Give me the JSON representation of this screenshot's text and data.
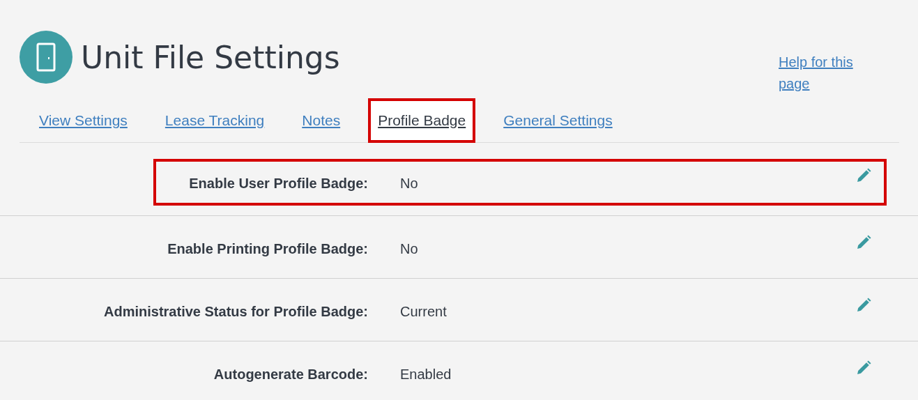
{
  "header": {
    "title": "Unit File Settings",
    "help_link": "Help for this page"
  },
  "tabs": [
    {
      "label": "View Settings",
      "selected": false,
      "highlighted": false
    },
    {
      "label": "Lease Tracking",
      "selected": false,
      "highlighted": false
    },
    {
      "label": "Notes",
      "selected": false,
      "highlighted": false
    },
    {
      "label": "Profile Badge",
      "selected": true,
      "highlighted": true
    },
    {
      "label": "General Settings",
      "selected": false,
      "highlighted": false
    }
  ],
  "settings": [
    {
      "label": "Enable User Profile Badge:",
      "value": "No",
      "highlighted": true
    },
    {
      "label": "Enable Printing Profile Badge:",
      "value": "No",
      "highlighted": false
    },
    {
      "label": "Administrative Status for Profile Badge:",
      "value": "Current",
      "highlighted": false
    },
    {
      "label": "Autogenerate Barcode:",
      "value": "Enabled",
      "highlighted": false
    }
  ]
}
